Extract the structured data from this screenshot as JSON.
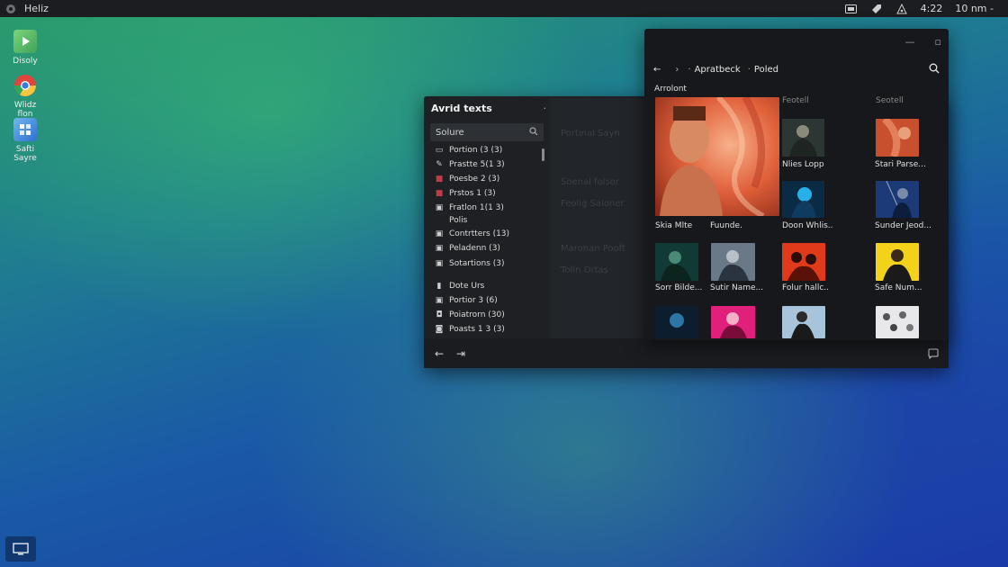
{
  "topbar": {
    "app_title": "Heliz",
    "time": "10 nm -",
    "clock_short": "4:22",
    "icons": [
      "launcher-icon",
      "keyboard-icon",
      "tag-icon",
      "network-icon"
    ]
  },
  "desktop": {
    "icons": [
      {
        "label": "Disoly",
        "icon": "play-store-icon"
      },
      {
        "label": "Wlidz flon",
        "icon": "chrome-icon"
      },
      {
        "label": "Safti Sayre",
        "icon": "settings-app-icon"
      }
    ]
  },
  "left_window": {
    "title": "Avrid texts",
    "search_placeholder": "Solure",
    "items": [
      {
        "label": "Portion (3 (3)",
        "icon": "folder-icon",
        "color": "#cfcfcf"
      },
      {
        "label": "Prastte 5(1 3)",
        "icon": "brush-icon",
        "color": "#cfcfcf"
      },
      {
        "label": "Poesbe 2 (3)",
        "icon": "square-red-icon",
        "color": "#c03a4a"
      },
      {
        "label": "Prstos 1 (3)",
        "icon": "square-red-icon",
        "color": "#c03a4a"
      },
      {
        "label": "Fratlon 1(1 3)",
        "icon": "image-icon",
        "color": "#cfcfcf"
      },
      {
        "label": "Polis",
        "icon": "",
        "color": "#cfcfcf"
      },
      {
        "label": "Contrtters (13)",
        "icon": "image-icon",
        "color": "#cfcfcf"
      },
      {
        "label": "Peladenn (3)",
        "icon": "image-icon",
        "color": "#cfcfcf"
      },
      {
        "label": "Sotartions (3)",
        "icon": "image-icon",
        "color": "#cfcfcf"
      },
      {
        "label": "Dote Urs",
        "icon": "mic-icon",
        "color": "#cfcfcf"
      },
      {
        "label": "Portior 3 (6)",
        "icon": "image-icon",
        "color": "#cfcfcf"
      },
      {
        "label": "Poiatrorn (30)",
        "icon": "camera-icon",
        "color": "#cfcfcf"
      },
      {
        "label": "Poasts 1 3 (3)",
        "icon": "lock-icon",
        "color": "#cfcfcf"
      }
    ],
    "mid_ghost": [
      "Portinal Sayn",
      "",
      "Soenal folsor",
      "Feolig Saloner",
      "Maronan Pooft",
      "Tolin Ortas"
    ]
  },
  "right_window": {
    "breadcrumb": [
      "Apratbeck",
      "Poled"
    ],
    "header_label": "Arrolont",
    "column_labels": [
      "Feotell",
      "Seotell"
    ],
    "tiles": [
      {
        "label": "Skia Mlte",
        "thumb": "portrait-orange"
      },
      {
        "label": "Fuunde.",
        "thumb": "portrait-orange"
      },
      {
        "label": "Nlies Lopp",
        "thumb": "figure-dark"
      },
      {
        "label": "Stari Parse...",
        "thumb": "figure-orange"
      },
      {
        "label": "Doon Whlis..",
        "thumb": "figure-blue"
      },
      {
        "label": "Sunder Jeod...",
        "thumb": "figure-blue-dark"
      },
      {
        "label": "Sorr Bilde...",
        "thumb": "figure-teal"
      },
      {
        "label": "Sutir Name...",
        "thumb": "figure-grey"
      },
      {
        "label": "Folur hallc..",
        "thumb": "figure-red"
      },
      {
        "label": "Safe Num...",
        "thumb": "figure-yellow"
      },
      {
        "label": "",
        "thumb": "figure-blue-mist"
      },
      {
        "label": "",
        "thumb": "figure-pink"
      },
      {
        "label": "",
        "thumb": "figure-sky"
      },
      {
        "label": "",
        "thumb": "figure-white"
      }
    ]
  },
  "colors": {
    "window_bg": "#1e2024",
    "accent_red": "#c03a4a"
  }
}
